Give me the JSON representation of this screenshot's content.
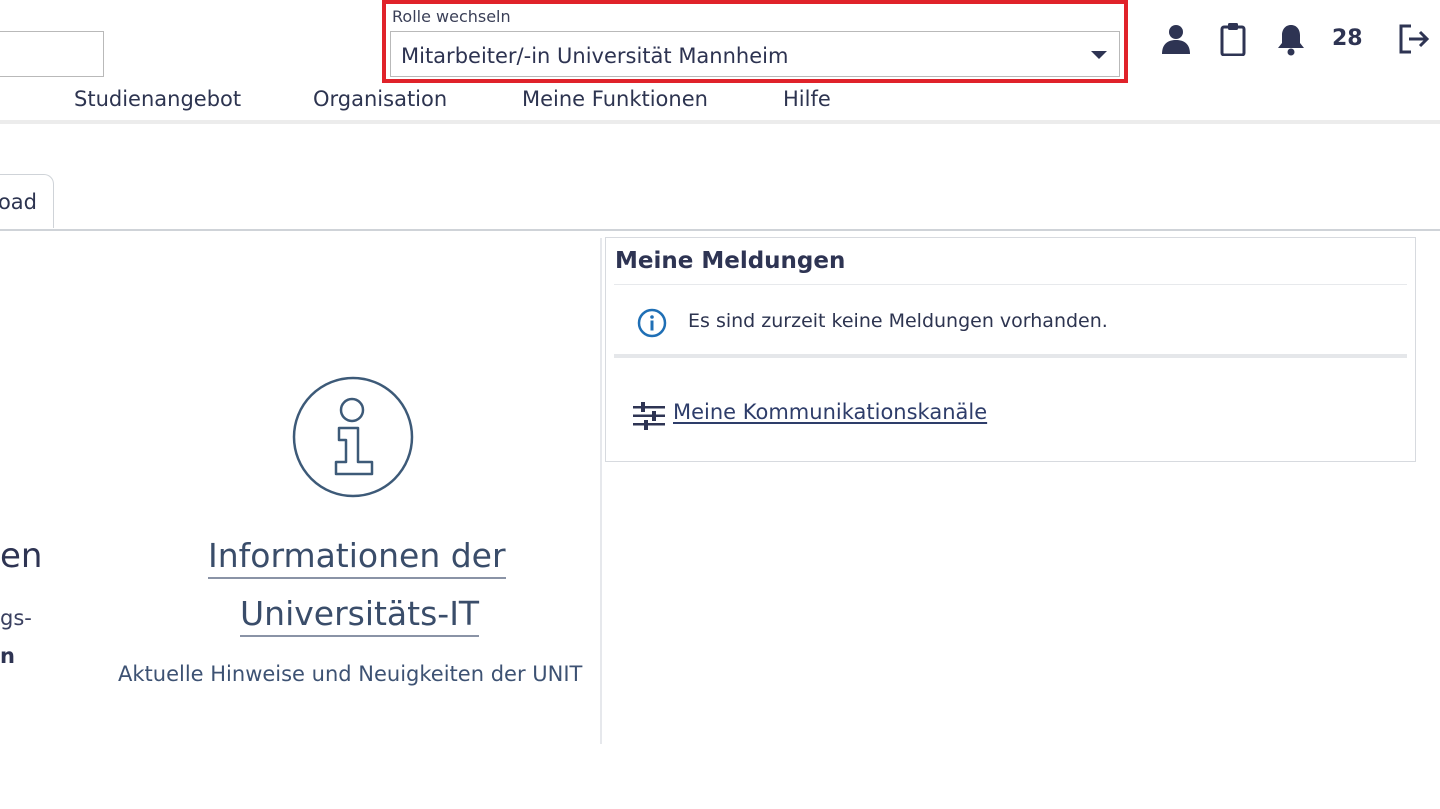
{
  "header": {
    "role_switch_label": "Rolle wechseln",
    "role_selected": "Mitarbeiter/-in Universität Mannheim",
    "notification_count": "28",
    "icons": [
      "user-icon",
      "clipboard-icon",
      "bell-icon",
      "logout-icon"
    ],
    "highlight_color": "#e0222a"
  },
  "nav": {
    "items": [
      "Studienangebot",
      "Organisation",
      "Meine Funktionen",
      "Hilfe"
    ]
  },
  "tabs": {
    "active_partial_label": "oad"
  },
  "left_panel": {
    "partial_heading": "en",
    "partial_line_1": "gs-",
    "partial_line_2": "n",
    "info_title_line_1": "Informationen der",
    "info_title_line_2": "Universitäts-IT",
    "info_subtitle": "Aktuelle Hinweise und Neuigkeiten der UNIT"
  },
  "messages_card": {
    "title": "Meine Meldungen",
    "empty_message": "Es sind zurzeit keine Meldungen vorhanden.",
    "channels_link": "Meine Kommunikationskanäle"
  }
}
